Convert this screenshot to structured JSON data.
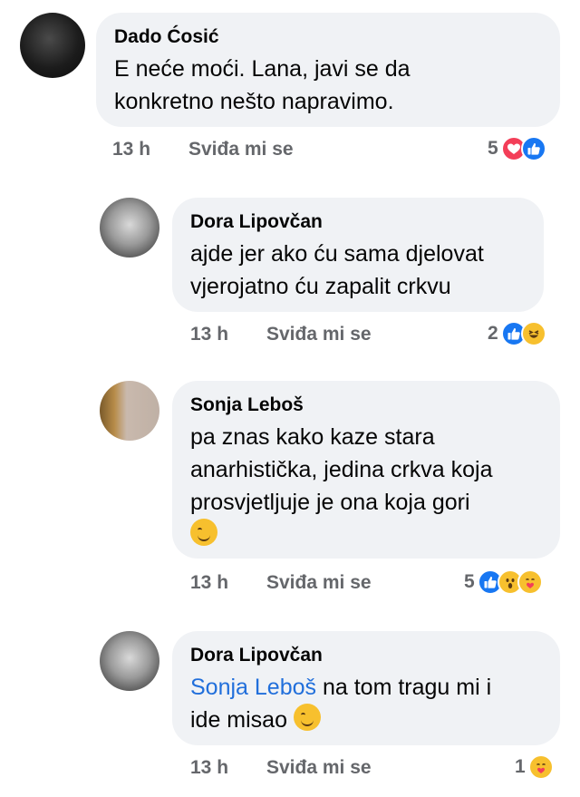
{
  "comments": [
    {
      "name": "Dado Ćosić",
      "text": "E neće moći. Lana, javi se da\nkonkretno nešto napravimo.",
      "time": "13 h",
      "like_label": "Sviđa mi se",
      "reaction_count": "5",
      "reactions": [
        "love",
        "like"
      ]
    },
    {
      "name": "Dora Lipovčan",
      "text": "ajde jer ako ću sama djelovat\nvjerojatno ću zapalit crkvu",
      "time": "13 h",
      "like_label": "Sviđa mi se",
      "reaction_count": "2",
      "reactions": [
        "like",
        "haha"
      ]
    },
    {
      "name": "Sonja Leboš",
      "text": "pa znas kako kaze stara\nanarhistička, jedina crkva koja\nprosvjetljuje je ona koja gori",
      "time": "13 h",
      "like_label": "Sviđa mi se",
      "reaction_count": "5",
      "reactions": [
        "like",
        "wow",
        "care"
      ]
    },
    {
      "name": "Dora Lipovčan",
      "mention": "Sonja Leboš",
      "text_after_mention": " na tom tragu mi i",
      "text_line2": "ide misao",
      "time": "13 h",
      "like_label": "Sviđa mi se",
      "reaction_count": "1",
      "reactions": [
        "care"
      ]
    }
  ],
  "colors": {
    "bubble": "#f0f2f5",
    "meta_text": "#65676b",
    "mention": "#216fdb",
    "like_blue": "#1877f2",
    "love_red": "#f33e58",
    "emoji_yellow": "#f7c02e"
  }
}
